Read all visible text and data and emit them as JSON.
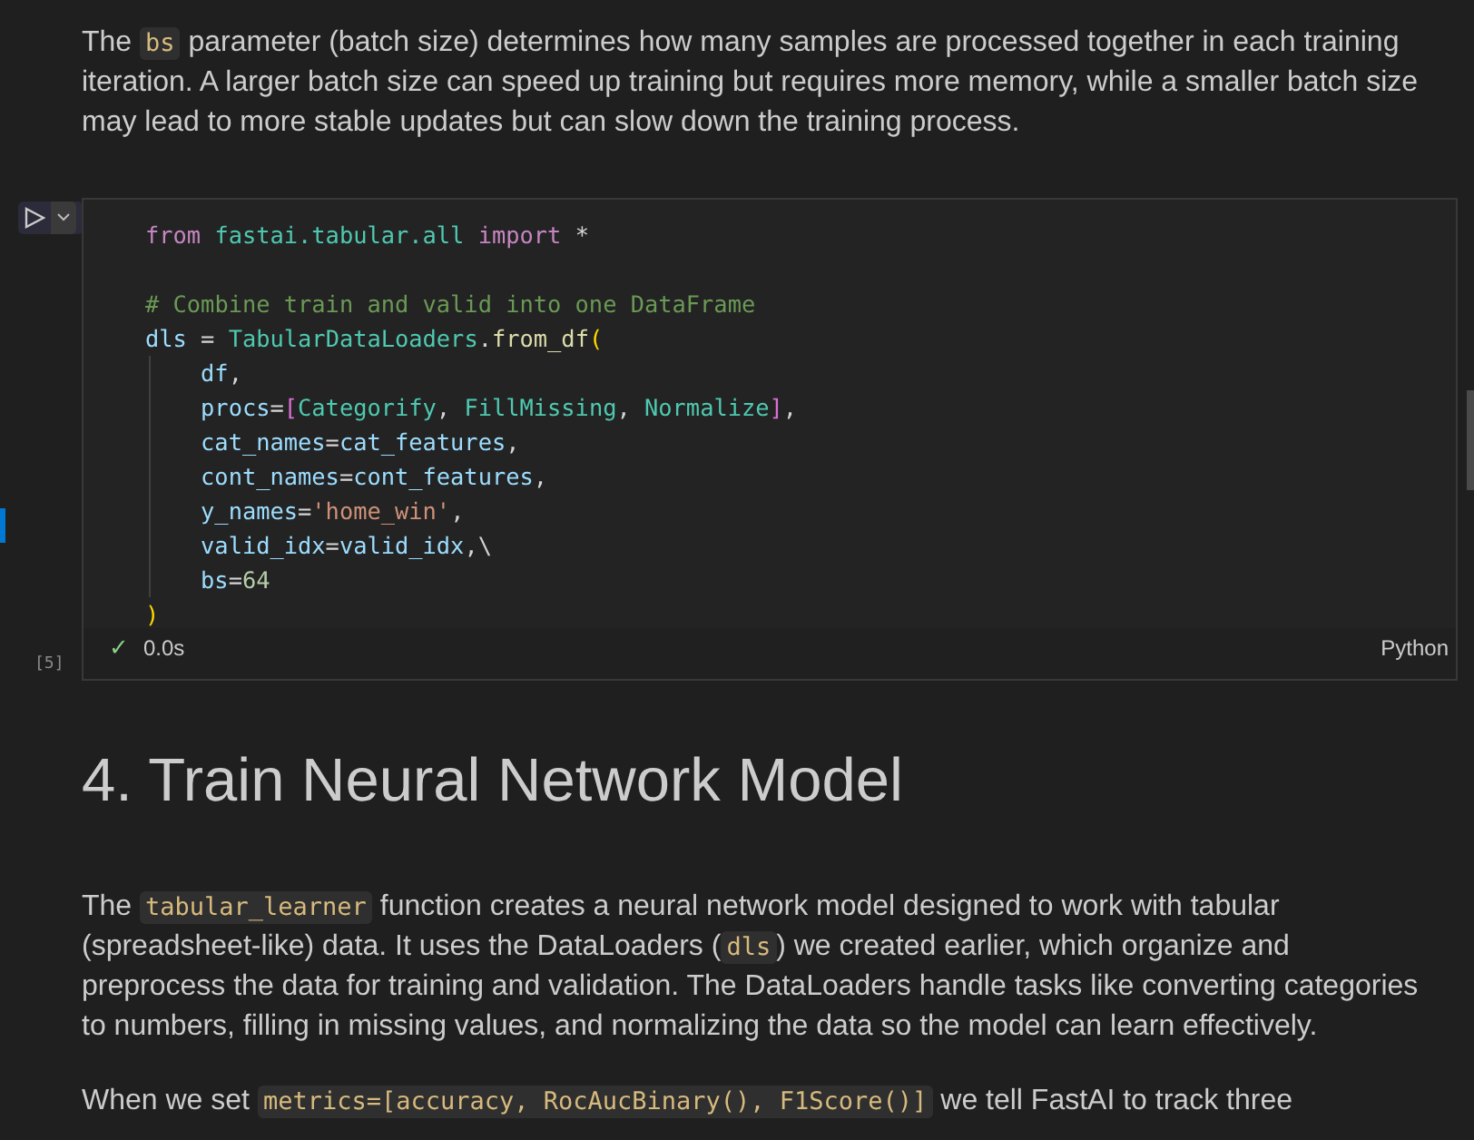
{
  "paragraph_1": [
    {
      "kind": "text",
      "text": "The "
    },
    {
      "kind": "code",
      "text": "bs"
    },
    {
      "kind": "text",
      "text": " parameter (batch size) determines how many samples are processed together in each training iteration. A larger batch size can speed up training but requires more memory, while a smaller batch size may lead to more stable updates but can slow down the training process."
    }
  ],
  "code_cell": {
    "execution_count": "[5]",
    "status": "✓",
    "duration": "0.0s",
    "language": "Python",
    "lines": [
      {
        "kind": "top",
        "tokens": [
          {
            "kind": "keyword",
            "text": "from "
          },
          {
            "kind": "module",
            "text": "fastai.tabular.all "
          },
          {
            "kind": "keyword",
            "text": "import "
          },
          {
            "kind": "plain",
            "text": "*"
          }
        ]
      },
      {
        "kind": "blank"
      },
      {
        "kind": "top",
        "tokens": [
          {
            "kind": "comment",
            "text": "# Combine train and valid into one DataFrame"
          }
        ]
      },
      {
        "kind": "top",
        "tokens": [
          {
            "kind": "variable",
            "text": "dls"
          },
          {
            "kind": "plain",
            "text": " = "
          },
          {
            "kind": "class",
            "text": "TabularDataLoaders"
          },
          {
            "kind": "plain",
            "text": "."
          },
          {
            "kind": "function",
            "text": "from_df"
          },
          {
            "kind": "paren",
            "text": "("
          }
        ]
      },
      {
        "kind": "argument",
        "tokens": [
          {
            "kind": "variable",
            "text": "df"
          },
          {
            "kind": "plain",
            "text": ","
          }
        ]
      },
      {
        "kind": "argument",
        "tokens": [
          {
            "kind": "variable",
            "text": "procs"
          },
          {
            "kind": "plain",
            "text": "="
          },
          {
            "kind": "bracket",
            "text": "["
          },
          {
            "kind": "class",
            "text": "Categorify"
          },
          {
            "kind": "plain",
            "text": ", "
          },
          {
            "kind": "class",
            "text": "FillMissing"
          },
          {
            "kind": "plain",
            "text": ", "
          },
          {
            "kind": "class",
            "text": "Normalize"
          },
          {
            "kind": "bracket",
            "text": "]"
          },
          {
            "kind": "plain",
            "text": ","
          }
        ]
      },
      {
        "kind": "argument",
        "tokens": [
          {
            "kind": "variable",
            "text": "cat_names"
          },
          {
            "kind": "plain",
            "text": "="
          },
          {
            "kind": "variable",
            "text": "cat_features"
          },
          {
            "kind": "plain",
            "text": ","
          }
        ]
      },
      {
        "kind": "argument",
        "tokens": [
          {
            "kind": "variable",
            "text": "cont_names"
          },
          {
            "kind": "plain",
            "text": "="
          },
          {
            "kind": "variable",
            "text": "cont_features"
          },
          {
            "kind": "plain",
            "text": ","
          }
        ]
      },
      {
        "kind": "argument",
        "tokens": [
          {
            "kind": "variable",
            "text": "y_names"
          },
          {
            "kind": "plain",
            "text": "="
          },
          {
            "kind": "string",
            "text": "'home_win'"
          },
          {
            "kind": "plain",
            "text": ","
          }
        ]
      },
      {
        "kind": "argument",
        "tokens": [
          {
            "kind": "variable",
            "text": "valid_idx"
          },
          {
            "kind": "plain",
            "text": "="
          },
          {
            "kind": "variable",
            "text": "valid_idx"
          },
          {
            "kind": "plain",
            "text": ",\\"
          }
        ]
      },
      {
        "kind": "argument",
        "tokens": [
          {
            "kind": "variable",
            "text": "bs"
          },
          {
            "kind": "plain",
            "text": "="
          },
          {
            "kind": "number",
            "text": "64"
          }
        ]
      },
      {
        "kind": "top",
        "tokens": [
          {
            "kind": "paren",
            "text": ")"
          }
        ]
      }
    ]
  },
  "heading": "4. Train Neural Network Model",
  "paragraph_2": [
    {
      "kind": "text",
      "text": "The "
    },
    {
      "kind": "code",
      "text": "tabular_learner"
    },
    {
      "kind": "text",
      "text": " function creates a neural network model designed to work with tabular (spreadsheet-like) data. It uses the DataLoaders ("
    },
    {
      "kind": "code",
      "text": "dls"
    },
    {
      "kind": "text",
      "text": ") we created earlier, which organize and preprocess the data for training and validation. The DataLoaders handle tasks like converting categories to numbers, filling in missing values, and normalizing the data so the model can learn effectively."
    }
  ],
  "paragraph_3": [
    {
      "kind": "text",
      "text": "When we set "
    },
    {
      "kind": "code",
      "text": "metrics=[accuracy, RocAucBinary(), F1Score()]"
    },
    {
      "kind": "text",
      "text": " we tell FastAI to track three"
    }
  ]
}
